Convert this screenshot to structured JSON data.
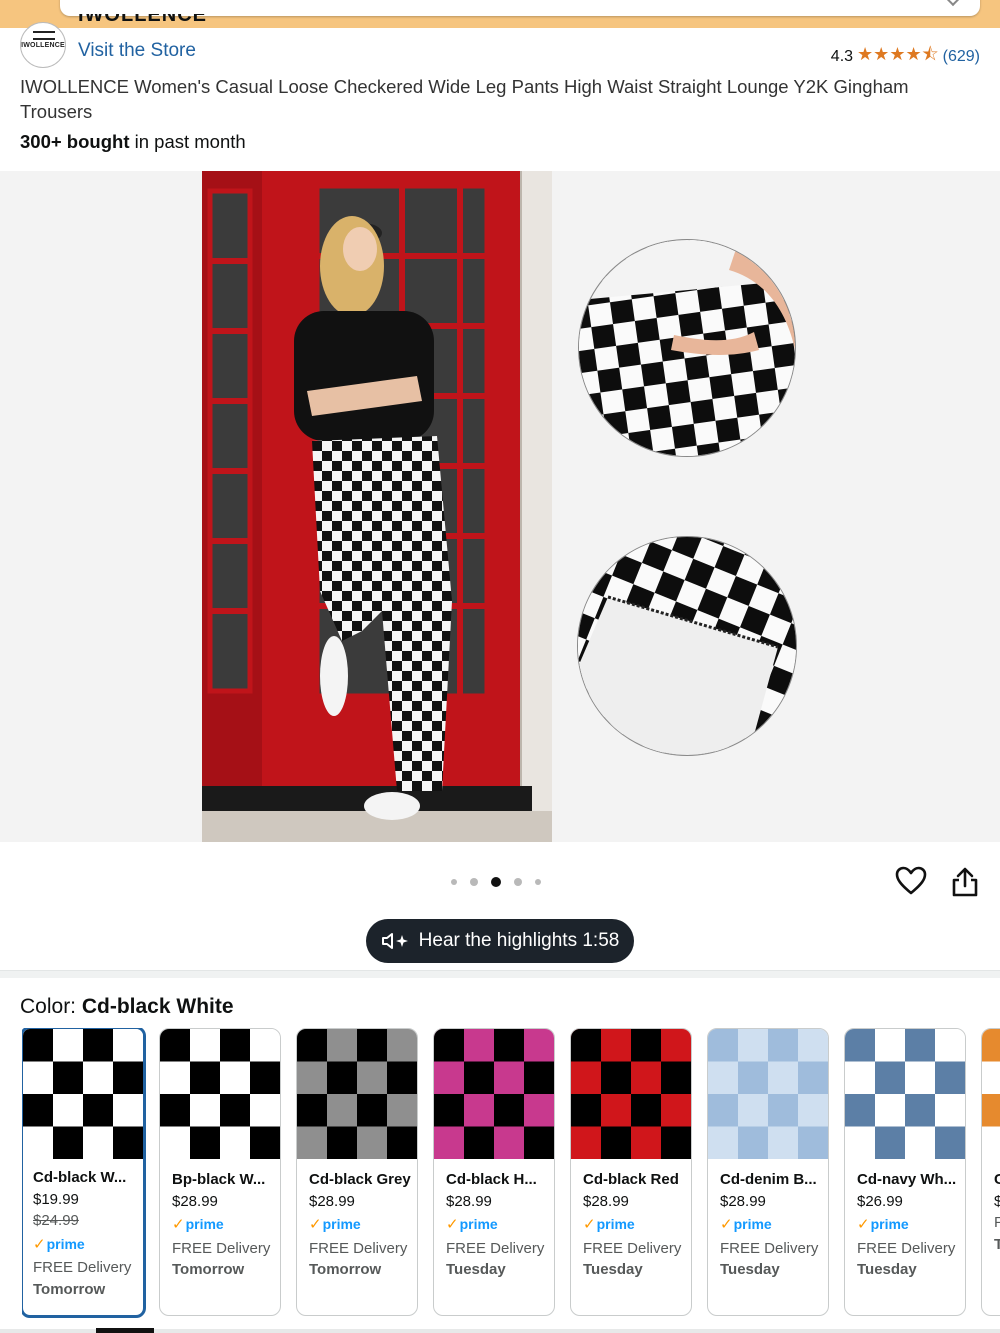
{
  "store": {
    "brand_cut": "IWOLLENCE",
    "logo_text": "IWOLLENCE",
    "visit_store": "Visit the Store"
  },
  "rating": {
    "value": "4.3",
    "stars": "★★★★⯪",
    "count": "(629)"
  },
  "product": {
    "title": "IWOLLENCE Women's Casual Loose Checkered Wide Leg Pants High Waist Straight Lounge Y2K Gingham Trousers",
    "bought_bold": "300+ bought",
    "bought_rest": " in past month"
  },
  "gallery": {
    "dots_count": 5,
    "active_dot": 2
  },
  "highlights": {
    "label": "Hear the highlights 1:58"
  },
  "color": {
    "label": "Color: ",
    "selected": "Cd-black White"
  },
  "swatches": [
    {
      "name": "Cd-black W...",
      "price": "$19.99",
      "strike": "$24.99",
      "prime": "prime",
      "delivery": "FREE Delivery",
      "day": "Tomorrow",
      "fg": "#000000",
      "bg": "#ffffff",
      "selected": true
    },
    {
      "name": "Bp-black W...",
      "price": "$28.99",
      "strike": "",
      "prime": "prime",
      "delivery": "FREE Delivery",
      "day": "Tomorrow",
      "fg": "#000000",
      "bg": "#ffffff",
      "selected": false
    },
    {
      "name": "Cd-black Grey",
      "price": "$28.99",
      "strike": "",
      "prime": "prime",
      "delivery": "FREE Delivery",
      "day": "Tomorrow",
      "fg": "#000000",
      "bg": "#8f8f8f",
      "selected": false
    },
    {
      "name": "Cd-black H...",
      "price": "$28.99",
      "strike": "",
      "prime": "prime",
      "delivery": "FREE Delivery",
      "day": "Tuesday",
      "fg": "#000000",
      "bg": "#c8398e",
      "selected": false
    },
    {
      "name": "Cd-black Red",
      "price": "$28.99",
      "strike": "",
      "prime": "prime",
      "delivery": "FREE Delivery",
      "day": "Tuesday",
      "fg": "#000000",
      "bg": "#d0161b",
      "selected": false
    },
    {
      "name": "Cd-denim B...",
      "price": "$28.99",
      "strike": "",
      "prime": "prime",
      "delivery": "FREE Delivery",
      "day": "Tuesday",
      "fg": "#9fbcdc",
      "bg": "#cfdff0",
      "selected": false
    },
    {
      "name": "Cd-navy Wh...",
      "price": "$26.99",
      "strike": "",
      "prime": "prime",
      "delivery": "FREE Delivery",
      "day": "Tuesday",
      "fg": "#5c7fa6",
      "bg": "#ffffff",
      "selected": false
    },
    {
      "name": "C",
      "price": "$",
      "strike": "",
      "prime": "",
      "delivery": "F",
      "day": "T",
      "fg": "#e68a2e",
      "bg": "#ffffff",
      "selected": false
    }
  ],
  "colors": {
    "link": "#2162a1",
    "star": "#de7921",
    "prime": "#1399ff",
    "top_band": "#f6c57f"
  }
}
